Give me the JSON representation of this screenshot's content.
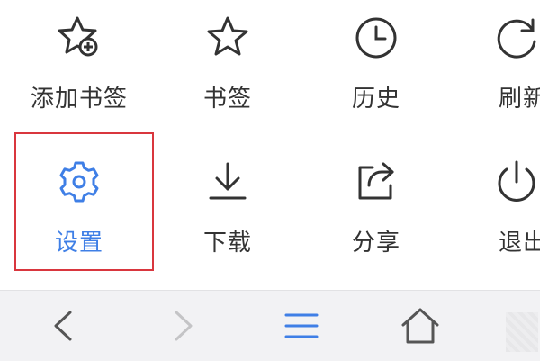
{
  "menu": {
    "items": [
      {
        "label": "添加书签",
        "icon": "star-add-icon"
      },
      {
        "label": "书签",
        "icon": "star-icon"
      },
      {
        "label": "历史",
        "icon": "clock-icon"
      },
      {
        "label": "刷新",
        "icon": "refresh-icon"
      },
      {
        "label": "设置",
        "icon": "gear-icon",
        "selected": true
      },
      {
        "label": "下载",
        "icon": "download-icon"
      },
      {
        "label": "分享",
        "icon": "share-icon"
      },
      {
        "label": "退出",
        "icon": "power-icon"
      }
    ]
  },
  "toolbar": {
    "buttons": [
      {
        "icon": "back-chevron-icon",
        "enabled": true
      },
      {
        "icon": "forward-chevron-icon",
        "enabled": false
      },
      {
        "icon": "hamburger-menu-icon",
        "enabled": true
      },
      {
        "icon": "home-icon",
        "enabled": true
      },
      {
        "icon": "tabs-icon",
        "enabled": true
      }
    ]
  },
  "colors": {
    "accent": "#3f7fe6",
    "highlight_border": "#d9363e",
    "icon_default": "#333333",
    "toolbar_bg": "#f2f2f4",
    "toolbar_icon": "#555555",
    "toolbar_icon_disabled": "#c4c4c6",
    "toolbar_menu_icon": "#3f7fe6"
  }
}
